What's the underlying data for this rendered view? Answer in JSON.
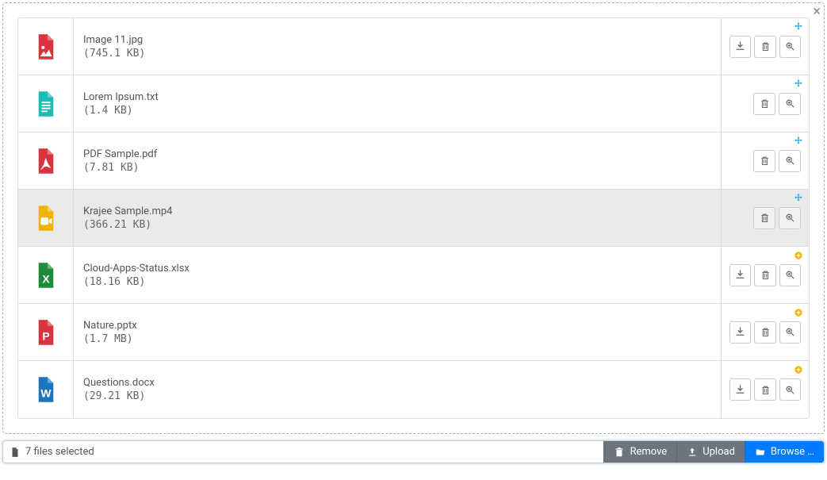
{
  "files": [
    {
      "name": "Image 11.jpg",
      "size": "(745.1 KB)",
      "iconType": "image",
      "iconColor": "#d9333f",
      "actions": [
        "download",
        "delete",
        "zoom"
      ],
      "corner": "move"
    },
    {
      "name": "Lorem Ipsum.txt",
      "size": "(1.4 KB)",
      "iconType": "text",
      "iconColor": "#1cbbb4",
      "actions": [
        "delete",
        "zoom"
      ],
      "corner": "move"
    },
    {
      "name": "PDF Sample.pdf",
      "size": "(7.81 KB)",
      "iconType": "pdf",
      "iconColor": "#d9333f",
      "actions": [
        "delete",
        "zoom"
      ],
      "corner": "move"
    },
    {
      "name": "Krajee Sample.mp4",
      "size": "(366.21 KB)",
      "iconType": "video",
      "iconColor": "#f0b400",
      "actions": [
        "delete",
        "zoom"
      ],
      "corner": "move",
      "hovered": true
    },
    {
      "name": "Cloud-Apps-Status.xlsx",
      "size": "(18.16 KB)",
      "iconType": "excel",
      "iconColor": "#1e8a3b",
      "actions": [
        "download",
        "delete",
        "zoom"
      ],
      "corner": "add"
    },
    {
      "name": "Nature.pptx",
      "size": "(1.7 MB)",
      "iconType": "ppt",
      "iconColor": "#d9333f",
      "actions": [
        "download",
        "delete",
        "zoom"
      ],
      "corner": "add"
    },
    {
      "name": "Questions.docx",
      "size": "(29.21 KB)",
      "iconType": "word",
      "iconColor": "#1e73be",
      "actions": [
        "download",
        "delete",
        "zoom"
      ],
      "corner": "add"
    }
  ],
  "caption": "7 files selected",
  "buttons": {
    "remove": "Remove",
    "upload": "Upload",
    "browse": "Browse …"
  }
}
